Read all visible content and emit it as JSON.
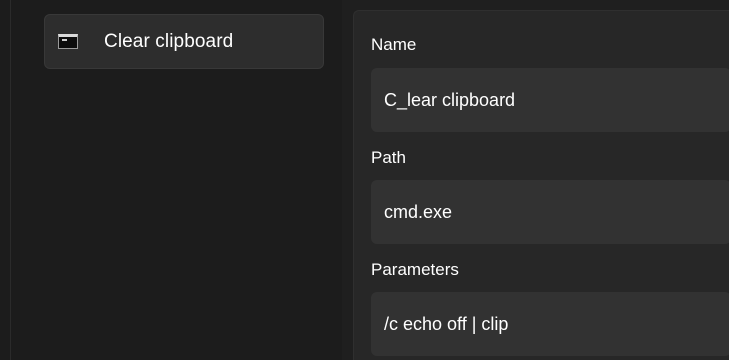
{
  "list": {
    "items": [
      {
        "label": "Clear clipboard",
        "icon": "command-prompt-icon"
      }
    ]
  },
  "form": {
    "name": {
      "label": "Name",
      "value": "C_lear clipboard"
    },
    "path": {
      "label": "Path",
      "value": "cmd.exe"
    },
    "parameters": {
      "label": "Parameters",
      "value": "/c echo off | clip"
    }
  },
  "colors": {
    "background": "#1f1f1f",
    "panel": "#272727",
    "input": "#323232",
    "item_selected": "#2d2d2d",
    "text": "#ffffff"
  }
}
